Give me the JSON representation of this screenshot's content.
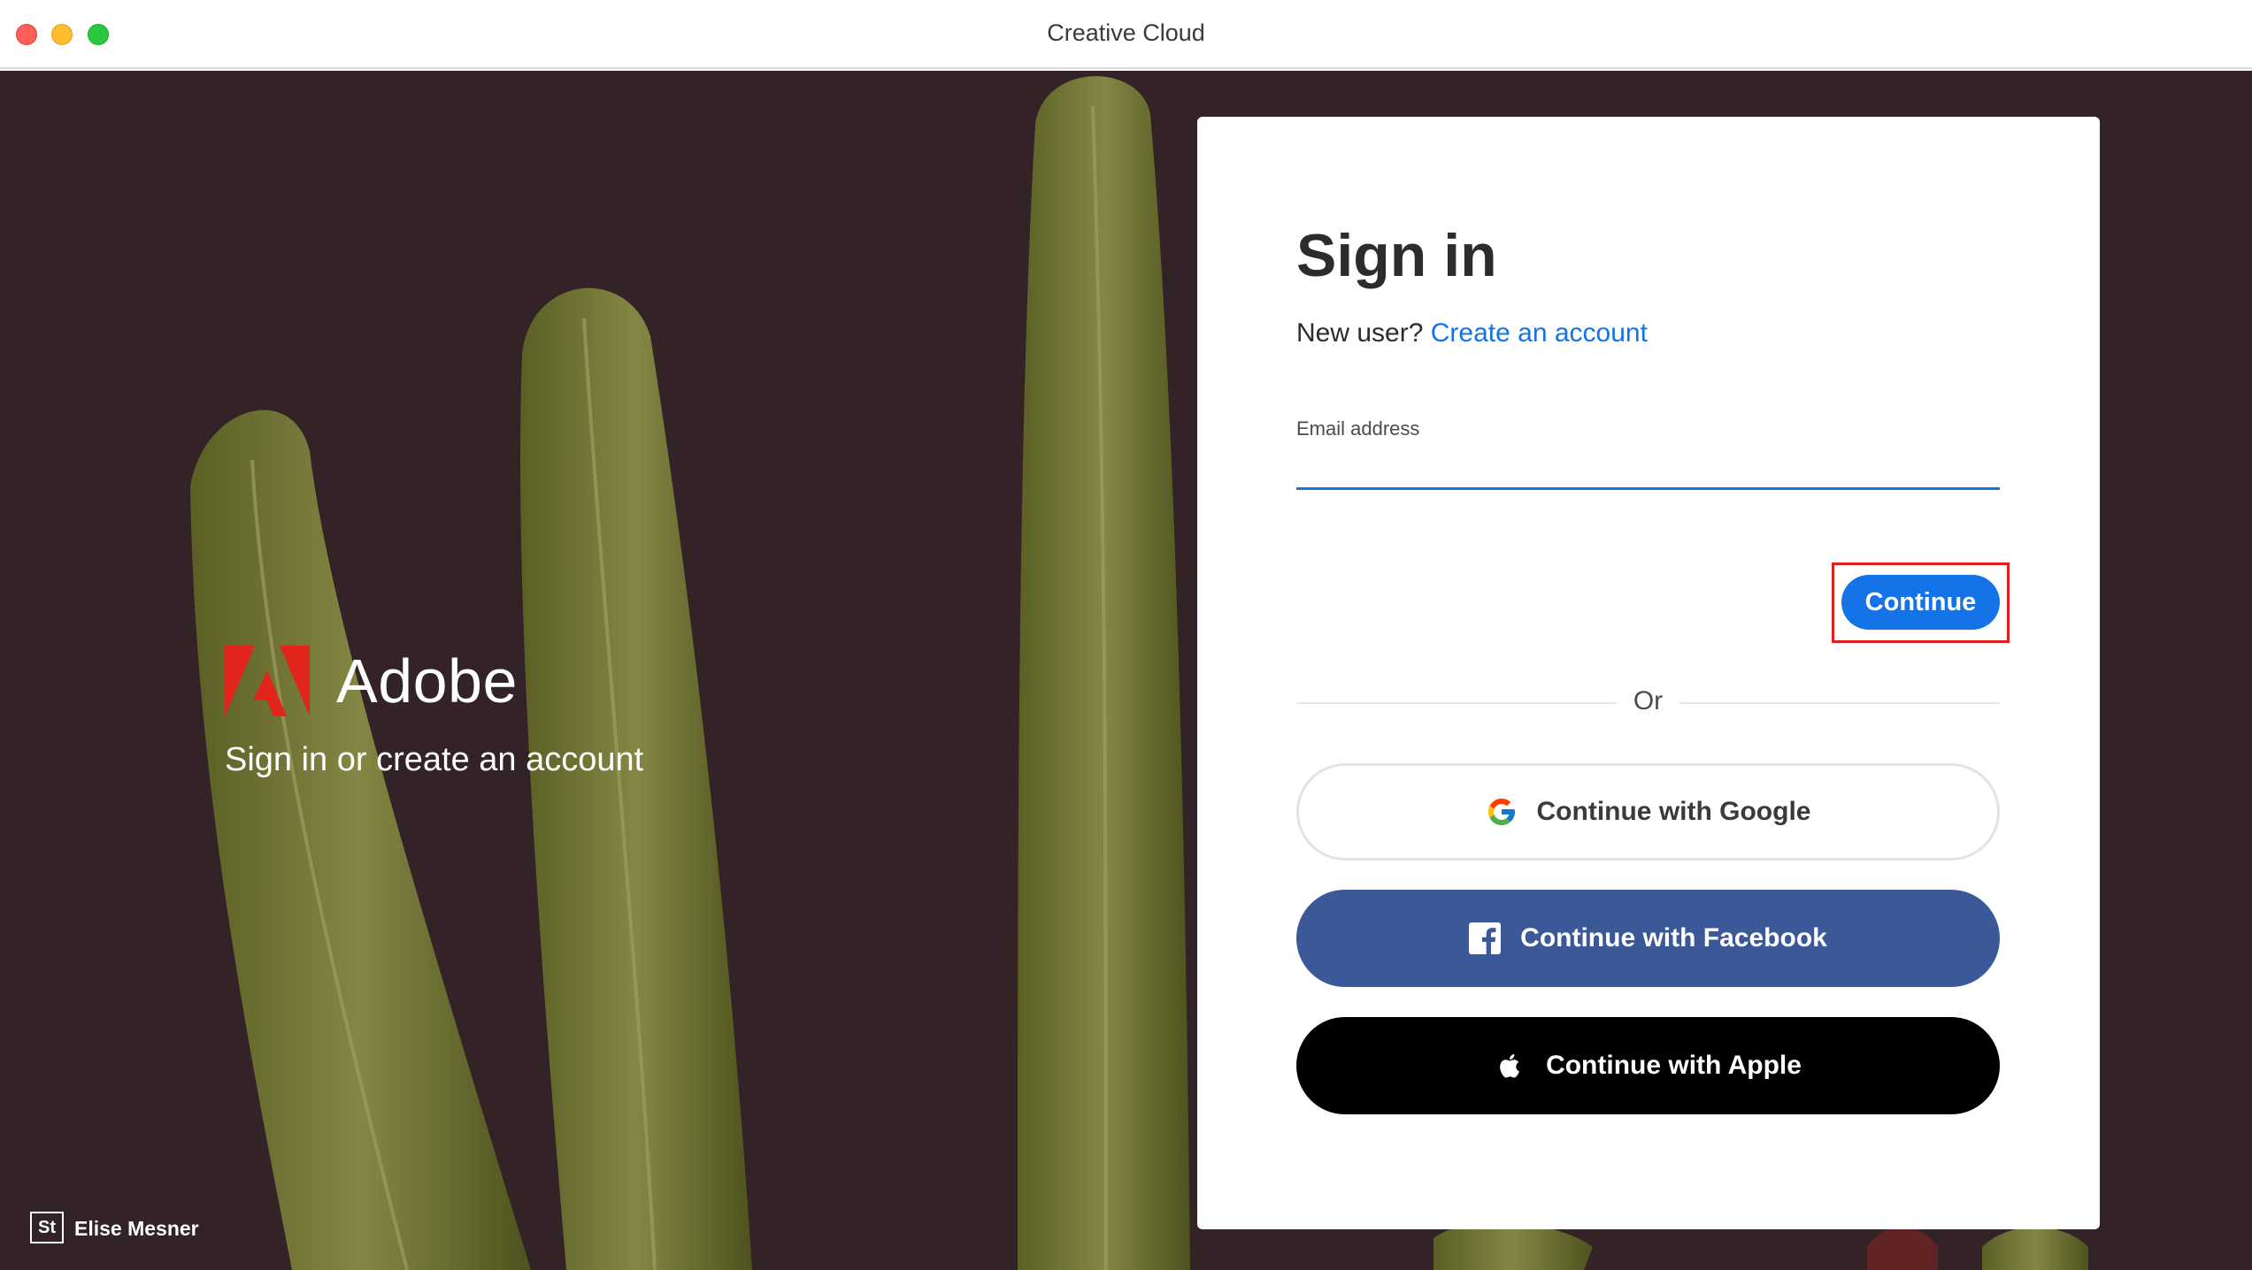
{
  "window": {
    "title": "Creative Cloud"
  },
  "branding": {
    "wordmark": "Adobe",
    "subtitle": "Sign in or create an account",
    "logo_color": "#e1251b"
  },
  "attribution": {
    "badge": "St",
    "name": "Elise Mesner"
  },
  "signin_card": {
    "title": "Sign in",
    "new_user_prompt": "New user?",
    "create_account_link": "Create an account",
    "email_label": "Email address",
    "email_value": "",
    "continue_button": "Continue",
    "or_divider": "Or",
    "google_button": "Continue with Google",
    "facebook_button": "Continue with Facebook",
    "apple_button": "Continue with Apple"
  },
  "icons": {
    "adobe_logo": "adobe-logo-icon",
    "google": "google-g-icon",
    "facebook": "facebook-f-icon",
    "apple": "apple-icon"
  },
  "colors": {
    "accent": "#1473e6",
    "facebook": "#3b5998",
    "apple": "#000000",
    "highlight": "#e02020",
    "background": "#3b2a2e"
  }
}
